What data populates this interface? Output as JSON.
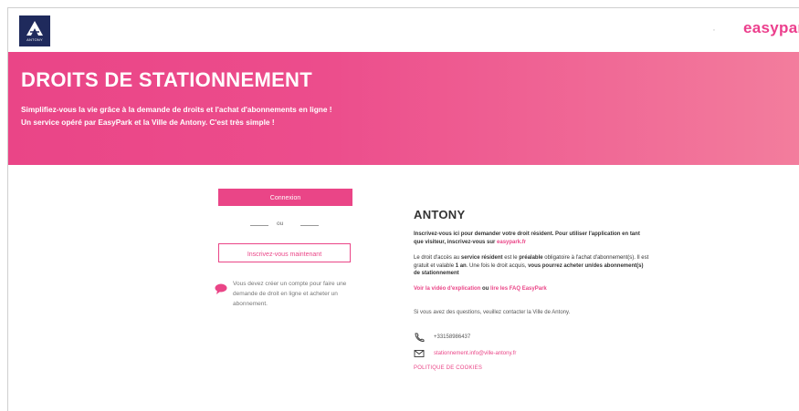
{
  "header": {
    "logo_text": "ANTONY",
    "lang_toggle": "·",
    "brand": "easypark"
  },
  "banner": {
    "title": "DROITS DE STATIONNEMENT",
    "subtitle": "Simplifiez-vous la vie grâce à la demande de droits et l'achat d'abonnements en ligne ! Un service opéré par EasyPark et la Ville de Antony. C'est très simple !"
  },
  "auth": {
    "login_label": "Connexion",
    "or_label": "ou",
    "register_label": "Inscrivez-vous maintenant",
    "info_text": "Vous devez créer un compte pour faire une demande de droit en ligne et acheter un abonnement."
  },
  "city": {
    "name": "ANTONY",
    "p1_text": "Inscrivez-vous ici pour demander votre droit résident. Pour utiliser l'application en tant que visiteur, inscrivez-vous sur",
    "p1_link": "easypark.fr",
    "p2_a": "Le droit d'accès au",
    "p2_b": "service résident",
    "p2_c": "est le",
    "p2_d": "préalable",
    "p2_e": "obligatoire à l'achat d'abonnement(s). Il est gratuit et valable",
    "p2_f": "1 an",
    "p2_g": ". Une fois le droit acquis,",
    "p2_h": "vous pourrez acheter un/des abonnement(s) de stationnement",
    "p3_link1": "Voir la vidéo d'explication",
    "p3_mid": "ou",
    "p3_link2": "lire les FAQ EasyPark",
    "p4_text": "Si vous avez des questions, veuillez contacter la Ville de Antony.",
    "phone": "+33158986437",
    "email": "stationnement.info@ville-antony.fr",
    "policy": "POLITIQUE DE COOKIES"
  },
  "colors": {
    "accent": "#ea4587",
    "navy": "#1f2a5c"
  },
  "icons": {
    "logo": "antony-logo",
    "info": "speech-bubble-icon",
    "phone": "phone-icon",
    "mail": "mail-icon"
  }
}
